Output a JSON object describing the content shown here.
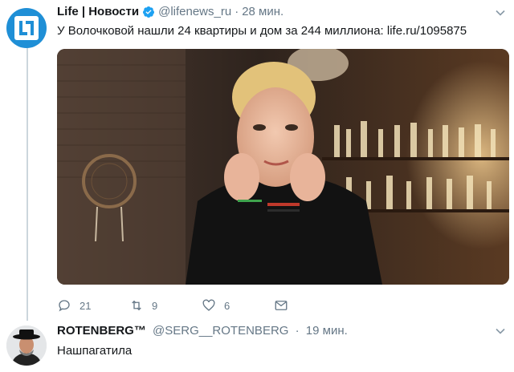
{
  "colors": {
    "accent": "#1da1f2",
    "muted": "#657786",
    "line": "#ccd6dd",
    "brand_life": "#1f8fd6"
  },
  "tweet1": {
    "author_name": "Life | Новости",
    "handle": "@lifenews_ru",
    "separator": "·",
    "time": "28 мин.",
    "text": "У Волочковой нашли 24 квартиры и дом за 244 миллиона: life.ru/1095875",
    "avatar_icon": "life-logo-icon",
    "actions": {
      "replies": "21",
      "retweets": "9",
      "likes": "6"
    }
  },
  "tweet2": {
    "author_name": "ROTENBERG™",
    "handle": "@SERG__ROTENBERG",
    "separator": "·",
    "time": "19 мин.",
    "text": "Нашпагатила"
  }
}
